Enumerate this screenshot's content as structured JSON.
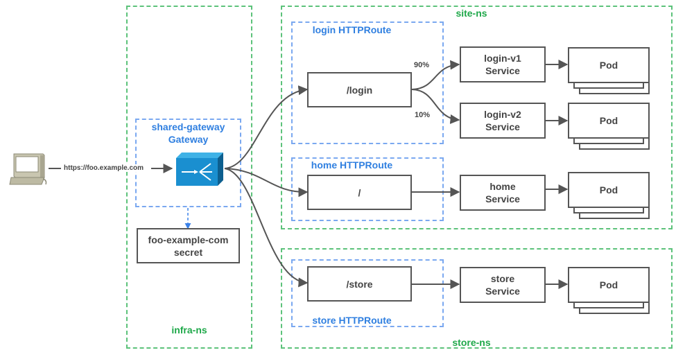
{
  "client": {
    "icon": "computer-icon",
    "url": "https://foo.example.com"
  },
  "namespaces": {
    "infra": "infra-ns",
    "site": "site-ns",
    "store": "store-ns"
  },
  "gateway": {
    "title_line1": "shared-gateway",
    "title_line2": "Gateway",
    "icon": "load-balancer-icon"
  },
  "secret": {
    "line1": "foo-example-com",
    "line2": "secret"
  },
  "routes": {
    "login": {
      "label": "login HTTPRoute",
      "path": "/login",
      "split": [
        "90%",
        "10%"
      ]
    },
    "home": {
      "label": "home HTTPRoute",
      "path": "/"
    },
    "store": {
      "label": "store HTTPRoute",
      "path": "/store"
    }
  },
  "services": {
    "login_v1": {
      "line1": "login-v1",
      "line2": "Service"
    },
    "login_v2": {
      "line1": "login-v2",
      "line2": "Service"
    },
    "home": {
      "line1": "home",
      "line2": "Service"
    },
    "store": {
      "line1": "store",
      "line2": "Service"
    }
  },
  "pods": {
    "label": "Pod"
  },
  "colors": {
    "namespace": "#5cc27a",
    "route": "#7aa8f0",
    "gateway": "#1a8fd0"
  }
}
